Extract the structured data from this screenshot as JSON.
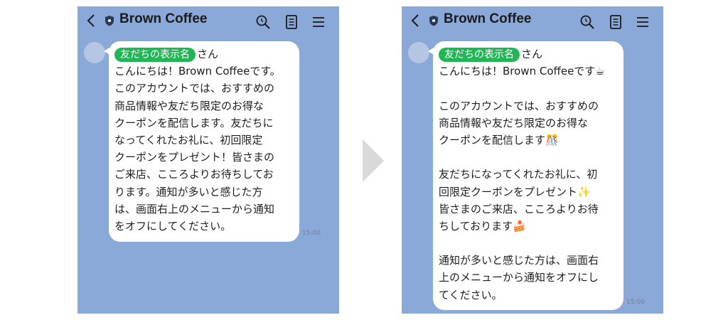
{
  "header": {
    "title": "Brown Coffee"
  },
  "tag_label": "友だちの表示名",
  "tag_suffix": "さん",
  "before": {
    "lines": [
      "こんにちは！Brown Coffeeです。",
      "このアカウントでは、おすすめの",
      "商品情報や友だち限定のお得な",
      "クーポンを配信します。友だちに",
      "なってくれたお礼に、初回限定",
      "クーポンをプレゼント！皆さまの",
      "ご来店、こころよりお待ちしてお",
      "ります。通知が多いと感じた方",
      "は、画面右上のメニューから通知",
      "をオフにしてください。"
    ],
    "time": "15:00"
  },
  "after": {
    "lines": [
      "こんにちは！Brown Coffeeです☕",
      "",
      "このアカウントでは、おすすめの",
      "商品情報や友だち限定のお得な",
      "クーポンを配信します🎊",
      "",
      "友だちになってくれたお礼に、初",
      "回限定クーポンをプレゼント✨",
      "皆さまのご来店、こころよりお待",
      "ちしております🍰",
      "",
      "通知が多いと感じた方は、画面右",
      "上のメニューから通知をオフにし",
      "てください。"
    ],
    "time": "15:00"
  },
  "icons": {
    "back": "chevron-left-icon",
    "badge": "shield-icon",
    "search": "search-icon",
    "notes": "notes-icon",
    "menu": "menu-icon"
  },
  "colors": {
    "chat_background": "#8aa8d8",
    "tag_green": "#1fb755",
    "arrow": "#d9d9d9"
  }
}
